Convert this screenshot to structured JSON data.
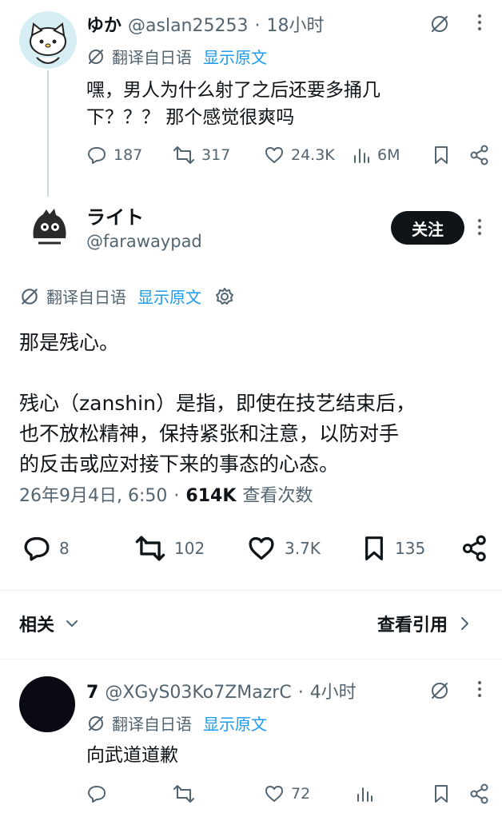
{
  "parent_post": {
    "display_name": "ゆか",
    "handle": "@aslan25253",
    "time": "18小时",
    "translate_label": "翻译自日语",
    "show_original": "显示原文",
    "text_line1": "嘿，男人为什么射了之后还要多捅几",
    "text_line2": "下？？？ 那个感觉很爽吗",
    "replies": "187",
    "reposts": "317",
    "likes": "24.3K",
    "views": "6M"
  },
  "main_post": {
    "display_name": "ライト",
    "handle": "@farawaypad",
    "follow_label": "关注",
    "translate_label": "翻译自日语",
    "show_original": "显示原文",
    "text_p1": "那是残心。",
    "text_p2_line1": "残心（zanshin）是指，即使在技艺结束后，",
    "text_p2_line2": "也不放松精神，保持紧张和注意，以防对手",
    "text_p2_line3": "的反击或应对接下来的事态的心态。",
    "timestamp": "26年9月4日, 6:50",
    "separator": "·",
    "views_count": "614K",
    "views_label": "查看次数",
    "replies": "8",
    "reposts": "102",
    "likes": "3.7K",
    "bookmarks": "135"
  },
  "related": {
    "label": "相关",
    "quotes_link": "查看引用"
  },
  "reply_post": {
    "display_name": "7",
    "handle": "@XGyS03Ko7ZMazrC",
    "time": "4小时",
    "translate_label": "翻译自日语",
    "show_original": "显示原文",
    "text": "向武道道歉",
    "likes": "72"
  },
  "meta_separator": "·"
}
